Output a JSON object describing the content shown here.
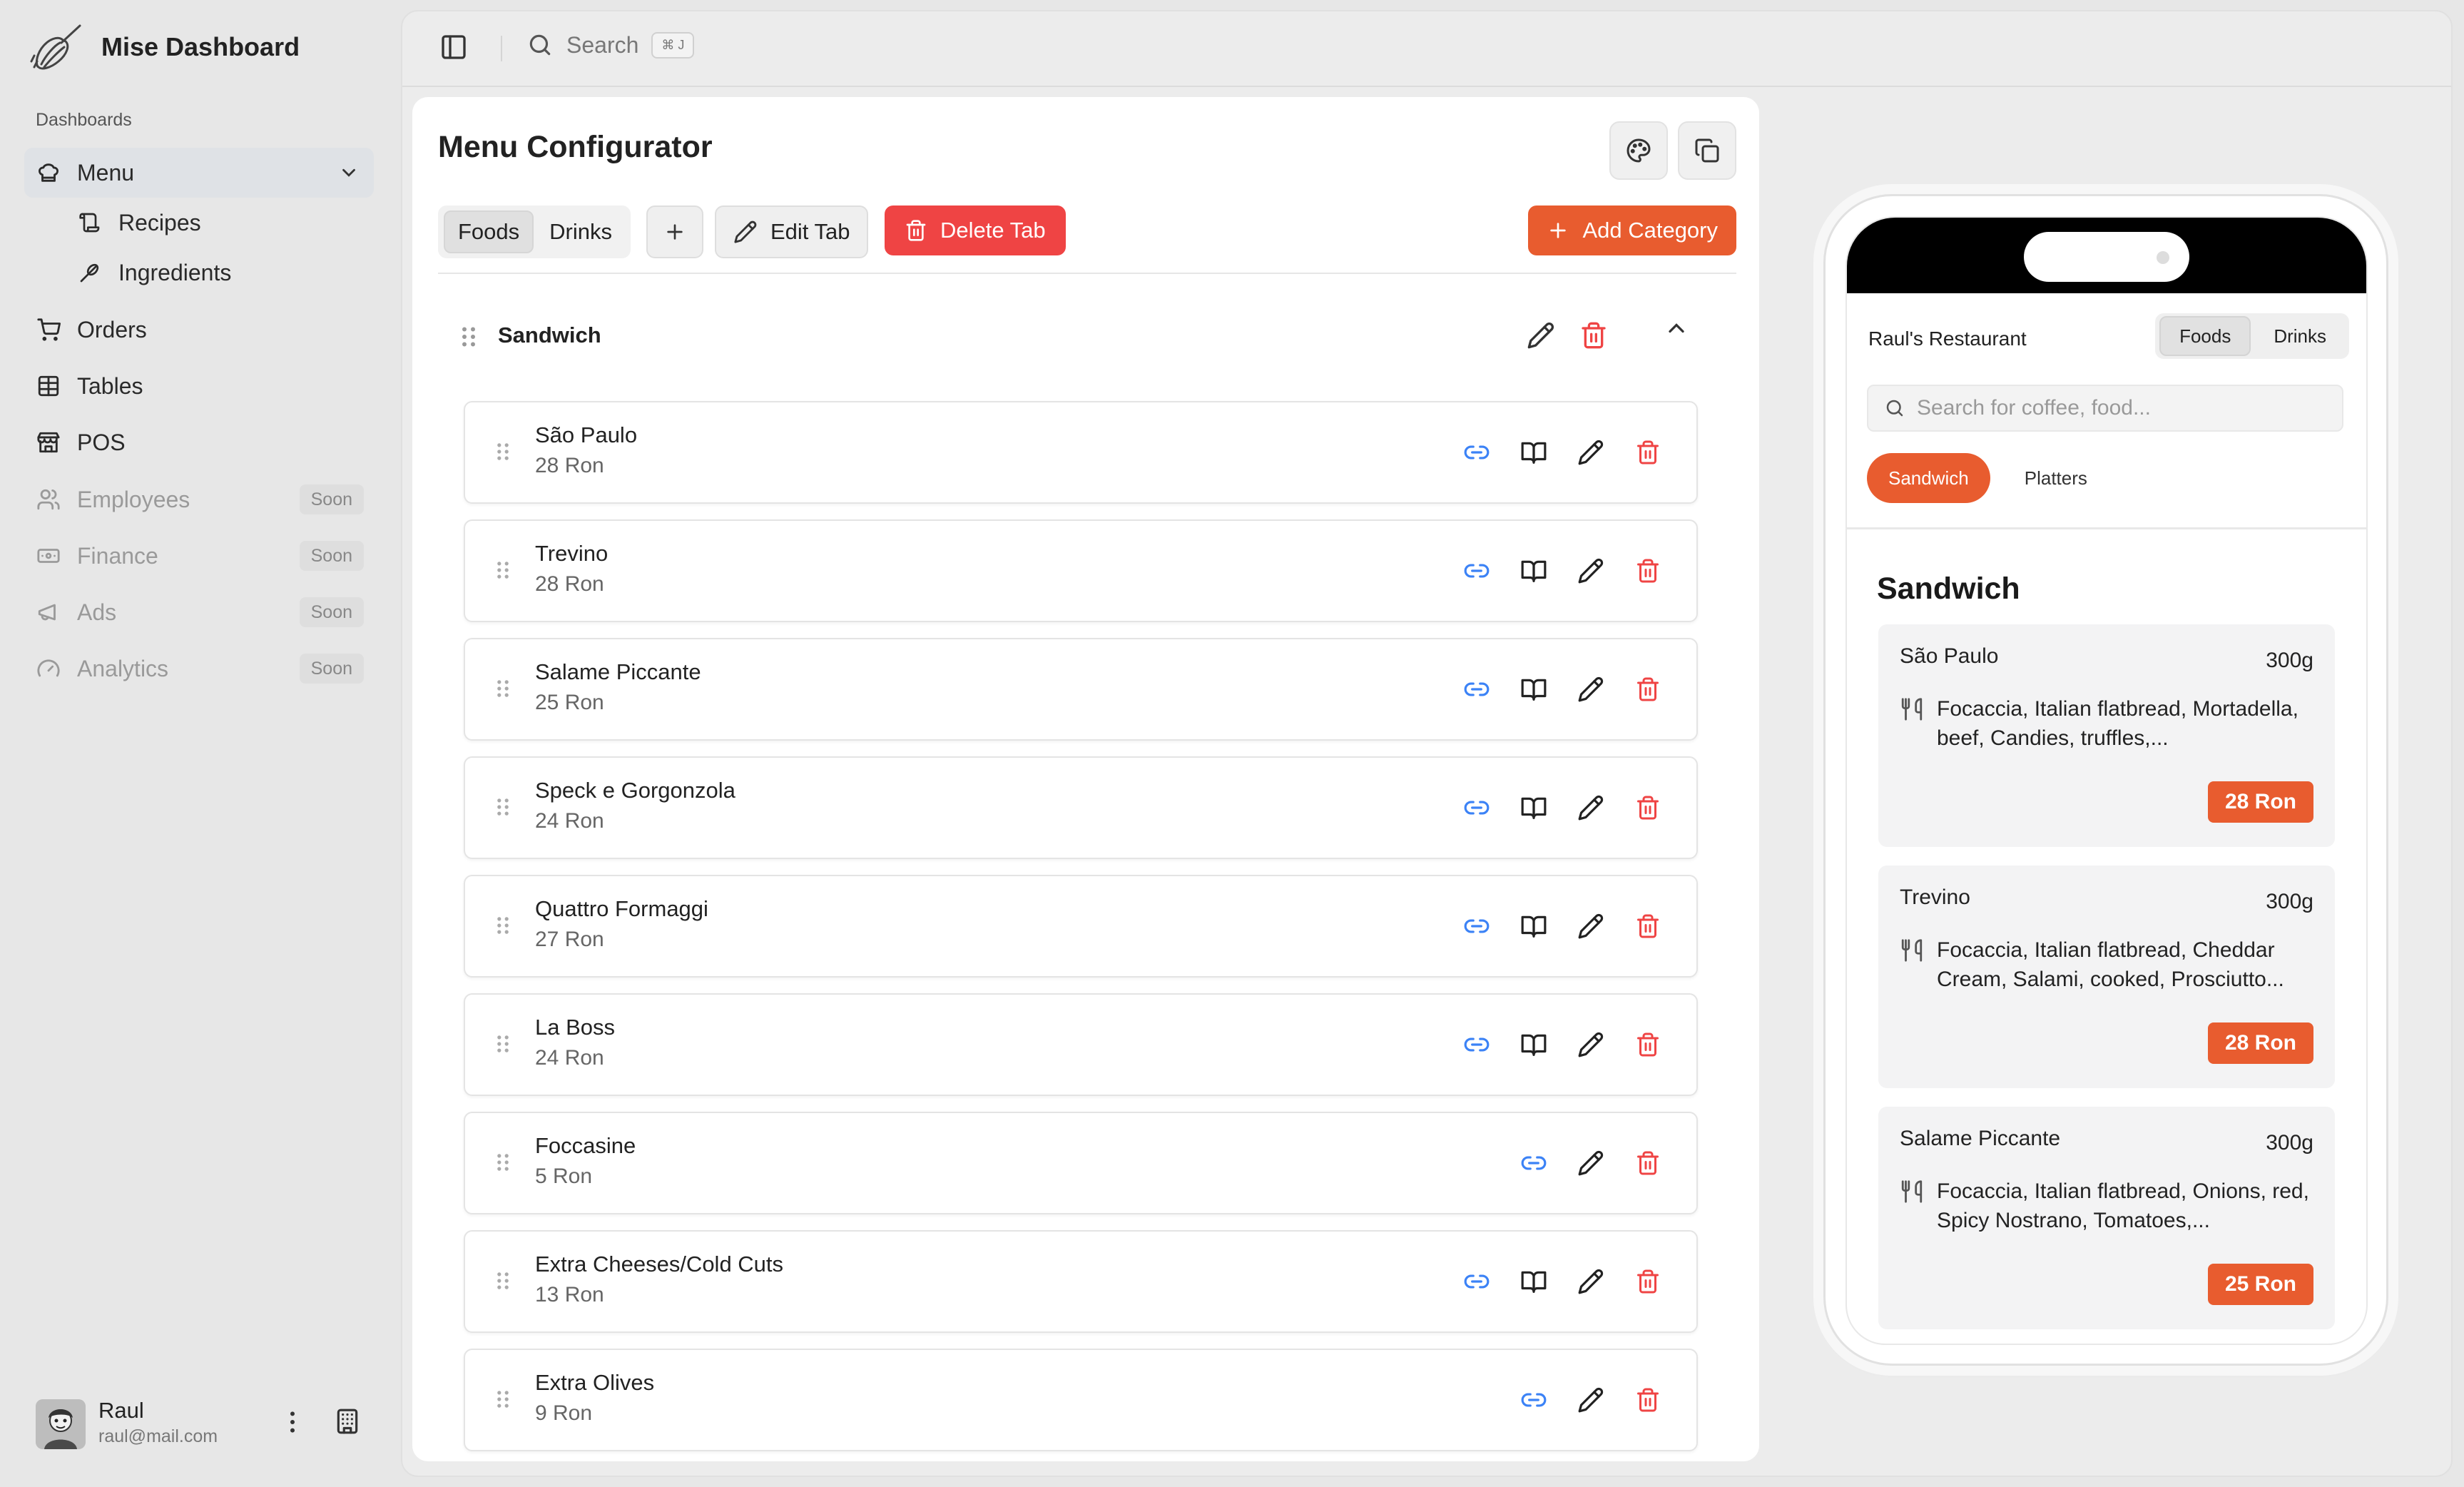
{
  "app": {
    "title": "Mise Dashboard"
  },
  "sidebar": {
    "section_label": "Dashboards",
    "items": [
      {
        "label": "Menu",
        "icon": "chef-hat-icon",
        "active": true,
        "expanded": true
      },
      {
        "label": "Recipes",
        "icon": "scroll-icon",
        "sub": true
      },
      {
        "label": "Ingredients",
        "icon": "wheat-icon",
        "sub": true
      },
      {
        "label": "Orders",
        "icon": "cart-icon"
      },
      {
        "label": "Tables",
        "icon": "table-icon"
      },
      {
        "label": "POS",
        "icon": "store-icon"
      },
      {
        "label": "Employees",
        "icon": "users-icon",
        "badge": "Soon",
        "disabled": true
      },
      {
        "label": "Finance",
        "icon": "banknote-icon",
        "badge": "Soon",
        "disabled": true
      },
      {
        "label": "Ads",
        "icon": "megaphone-icon",
        "badge": "Soon",
        "disabled": true
      },
      {
        "label": "Analytics",
        "icon": "gauge-icon",
        "badge": "Soon",
        "disabled": true
      }
    ],
    "user": {
      "name": "Raul",
      "email": "raul@mail.com"
    }
  },
  "topbar": {
    "search_label": "Search",
    "shortcut": "⌘ J"
  },
  "configurator": {
    "title": "Menu Configurator",
    "tabs": [
      {
        "label": "Foods",
        "active": true
      },
      {
        "label": "Drinks",
        "active": false
      }
    ],
    "edit_tab": "Edit Tab",
    "delete_tab": "Delete Tab",
    "add_category": "Add Category",
    "category": {
      "name": "Sandwich"
    },
    "items": [
      {
        "name": "São Paulo",
        "price": "28 Ron",
        "has_recipe": true
      },
      {
        "name": "Trevino",
        "price": "28 Ron",
        "has_recipe": true
      },
      {
        "name": "Salame Piccante",
        "price": "25 Ron",
        "has_recipe": true
      },
      {
        "name": "Speck e Gorgonzola",
        "price": "24 Ron",
        "has_recipe": true
      },
      {
        "name": "Quattro Formaggi",
        "price": "27 Ron",
        "has_recipe": true
      },
      {
        "name": "La Boss",
        "price": "24 Ron",
        "has_recipe": true
      },
      {
        "name": "Foccasine",
        "price": "5 Ron",
        "has_recipe": false
      },
      {
        "name": "Extra Cheeses/Cold Cuts",
        "price": "13 Ron",
        "has_recipe": true
      },
      {
        "name": "Extra Olives",
        "price": "9 Ron",
        "has_recipe": false
      }
    ]
  },
  "preview": {
    "restaurant": "Raul's Restaurant",
    "tabs": [
      {
        "label": "Foods",
        "active": true
      },
      {
        "label": "Drinks",
        "active": false
      }
    ],
    "search_placeholder": "Search for coffee, food...",
    "chips": [
      {
        "label": "Sandwich",
        "active": true
      },
      {
        "label": "Platters",
        "active": false
      }
    ],
    "category": "Sandwich",
    "items": [
      {
        "name": "São Paulo",
        "weight": "300g",
        "desc": "Focaccia, Italian flatbread, Mortadella, beef, Candies, truffles,...",
        "price": "28 Ron"
      },
      {
        "name": "Trevino",
        "weight": "300g",
        "desc": "Focaccia, Italian flatbread, Cheddar Cream, Salami, cooked, Prosciutto...",
        "price": "28 Ron"
      },
      {
        "name": "Salame Piccante",
        "weight": "300g",
        "desc": "Focaccia, Italian flatbread, Onions, red, Spicy Nostrano, Tomatoes,...",
        "price": "25 Ron"
      }
    ]
  },
  "colors": {
    "accent": "#e85c2f",
    "danger": "#ef4444",
    "link": "#3b82f6"
  }
}
